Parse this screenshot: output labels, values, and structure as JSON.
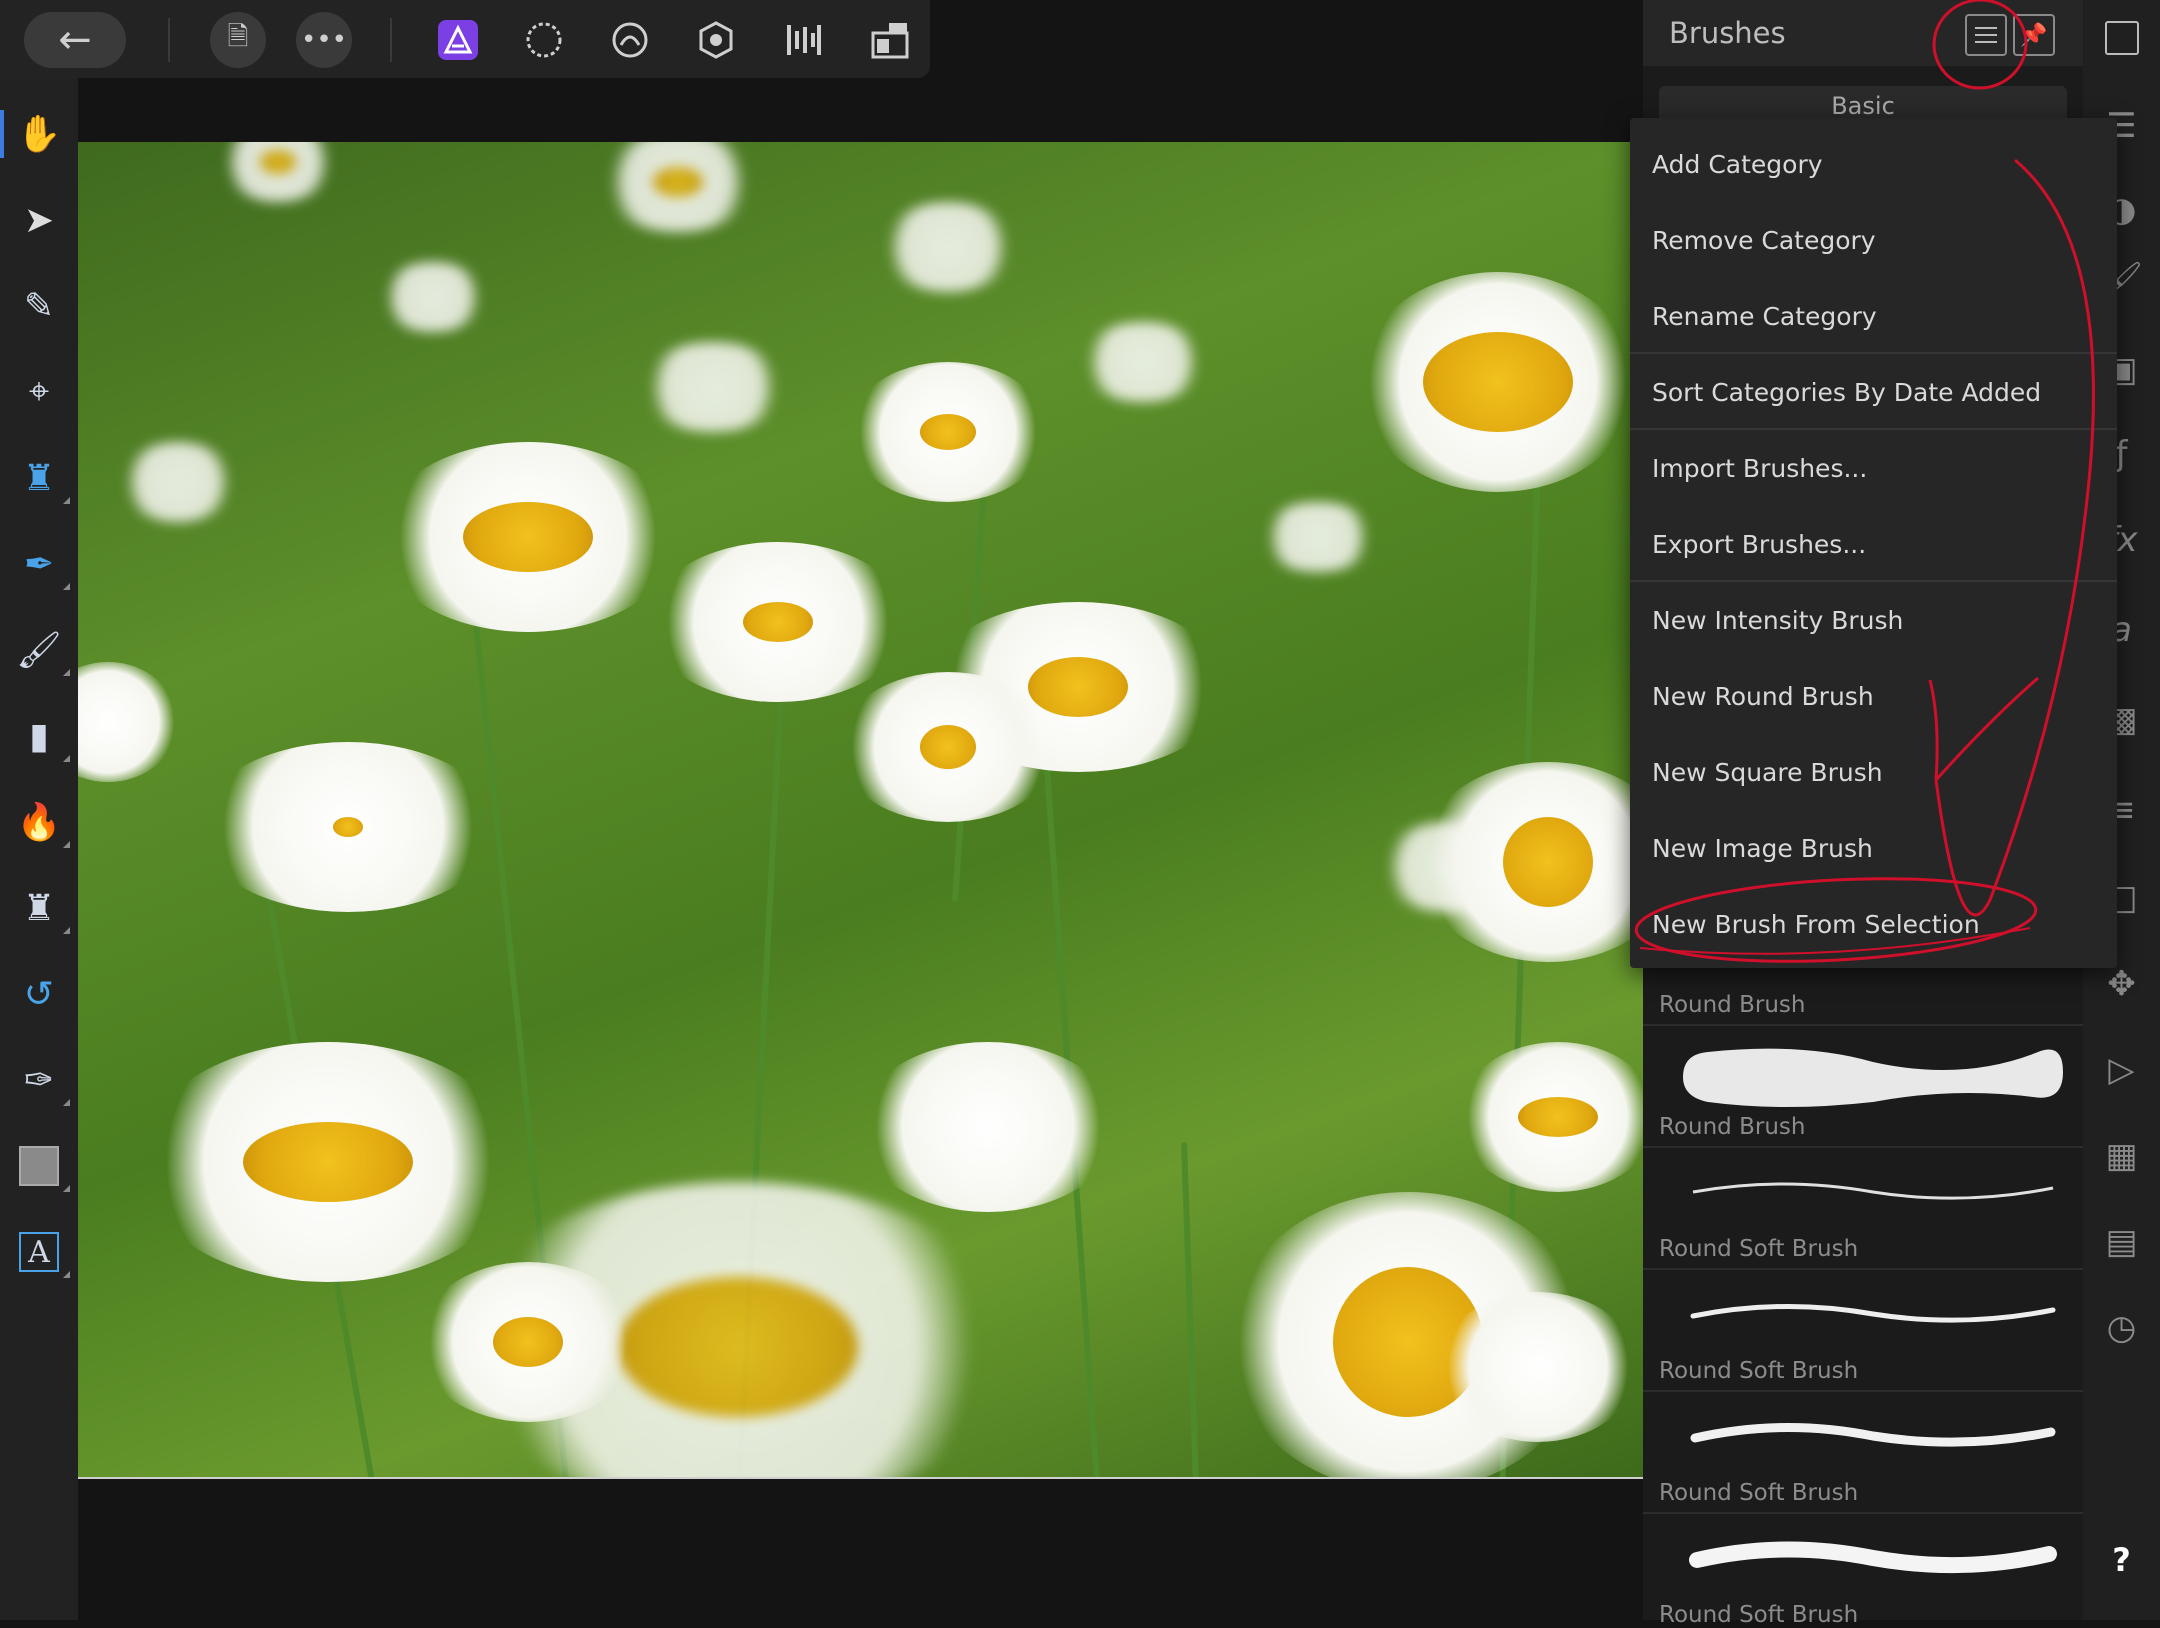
{
  "toolbar": {
    "back_icon": "arrow-left-icon",
    "document_icon": "document-icon",
    "more_icon": "ellipsis-icon",
    "personas": [
      "photo-persona-icon",
      "liquify-persona-icon",
      "develop-persona-icon",
      "tone-mapping-persona-icon",
      "export-persona-icon",
      "layout-icon"
    ]
  },
  "left_tools": [
    "hand-icon",
    "move-icon",
    "color-picker-icon",
    "crop-icon",
    "flood-fill-icon",
    "selection-brush-icon",
    "paint-brush-icon",
    "erase-brush-icon",
    "burn-icon",
    "clone-icon",
    "undo-brush-icon",
    "pen-icon",
    "rectangle-icon",
    "text-icon"
  ],
  "brushes_panel": {
    "title": "Brushes",
    "category_label": "Basic",
    "items": [
      {
        "label": "Round Brush"
      },
      {
        "label": "Round Brush"
      },
      {
        "label": "Round Soft Brush"
      },
      {
        "label": "Round Soft Brush"
      },
      {
        "label": "Round Soft Brush"
      },
      {
        "label": "Round Soft Brush"
      }
    ]
  },
  "context_menu": {
    "items": [
      "Add Category",
      "Remove Category",
      "Rename Category",
      "Sort Categories By Date Added",
      "Import Brushes...",
      "Export Brushes...",
      "New Intensity Brush",
      "New Round Brush",
      "New Square Brush",
      "New Image Brush",
      "New Brush From Selection"
    ]
  },
  "right_strip": [
    "fullscreen-icon",
    "layers-icon",
    "color-icon",
    "brushes-icon",
    "adjustments-icon",
    "effects-icon",
    "text-styles-icon",
    "stock-icon",
    "navigator-icon",
    "macro-icon",
    "transform-icon",
    "channels-icon",
    "histogram-icon",
    "history-icon",
    "help-icon"
  ],
  "help_label": "?",
  "colors": {
    "accent": "#3d7be0",
    "annotation": "#d0102a",
    "panel_bg": "#1b1b1b",
    "menu_bg": "#262626"
  }
}
